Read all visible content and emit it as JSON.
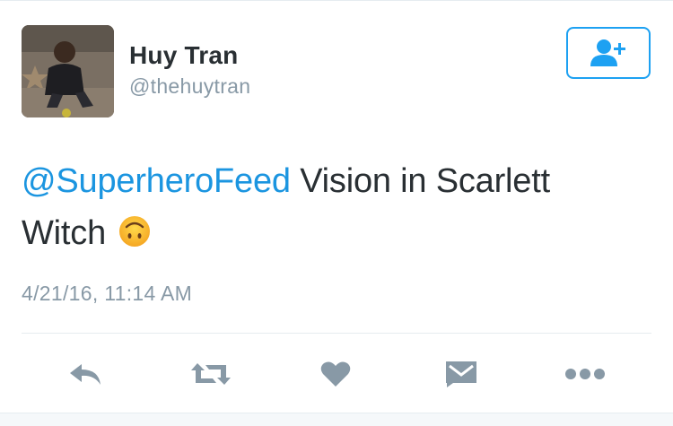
{
  "user": {
    "display_name": "Huy Tran",
    "handle": "@thehuytran",
    "avatar_icon": "profile-photo"
  },
  "follow_button": {
    "icon": "follow-person-plus-icon",
    "color": "#1da1f2"
  },
  "tweet": {
    "mention": "@SuperheroFeed",
    "text_line1_rest": " Vision in Scarlett",
    "text_line2": "Witch",
    "emoji": "upside-down-face-emoji",
    "timestamp": "4/21/16, 11:14 AM"
  },
  "actions": [
    {
      "name": "reply",
      "icon": "reply-icon"
    },
    {
      "name": "retweet",
      "icon": "retweet-icon"
    },
    {
      "name": "like",
      "icon": "heart-icon"
    },
    {
      "name": "direct-message",
      "icon": "envelope-icon"
    },
    {
      "name": "more",
      "icon": "more-dots-icon"
    }
  ],
  "colors": {
    "text": "#292f33",
    "secondary": "#8899a6",
    "link": "#1b95e0",
    "action_icon": "#8899a6"
  }
}
